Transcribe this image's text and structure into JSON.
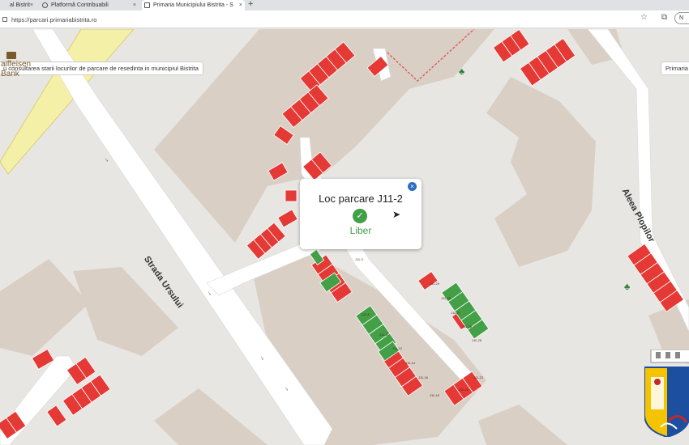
{
  "browser": {
    "tabs": [
      {
        "label": "al Bistrit",
        "active": false
      },
      {
        "label": "Platformă Contribuabili",
        "active": false
      },
      {
        "label": "Primaria Municipiului Bistrita - S",
        "active": true
      }
    ],
    "url": "https://parcari.primariabistrita.ro",
    "profile_label": "N"
  },
  "map": {
    "top_tooltip": "u consultarea starii locurilor de parcare de resedinta in municipiul Bistrita",
    "right_tooltip": "Primaria",
    "bank_name": "aiffeisen\nBank",
    "streets": {
      "ursului": "Strada Ursului",
      "plopilor": "Aleea Plopilor"
    },
    "timestamp": "",
    "colors": {
      "free": "#43a047",
      "occupied": "#e53935",
      "building": "#d9cfc5",
      "road": "#ffffff",
      "background": "#e8e6e3",
      "main_road": "#f5f0a8"
    },
    "spot_labels": {
      "J11-2": "J11-2",
      "J11-3": "J11-3",
      "J11-4": "J11-4",
      "J11-5": "J11-5",
      "J11-6": "J11-6",
      "J11-8": "J11-8",
      "J11-9": "J11-9",
      "J11-10": "J11-10",
      "J11-11": "J11-11",
      "J11-12": "J11-12",
      "J11-13": "J11-13",
      "J11-14": "J11-14",
      "J11-15": "J11-15",
      "J11-16": "J11-16",
      "J11-18": "J11-18",
      "J11-19": "J11-19",
      "J11-20": "J11-20",
      "J11-21": "J11-21",
      "J11-22": "J11-22",
      "J11-23": "J11-23",
      "J11-24": "J11-24",
      "J11-25": "J11-25",
      "J11-26": "J11-26",
      "J11-27": "J11-27",
      "J11-28": "J11-28",
      "J11-29": "J11-29"
    }
  },
  "popup": {
    "title": "Loc parcare J11-2",
    "status": "Liber",
    "close_label": "×",
    "check_label": "✓"
  }
}
